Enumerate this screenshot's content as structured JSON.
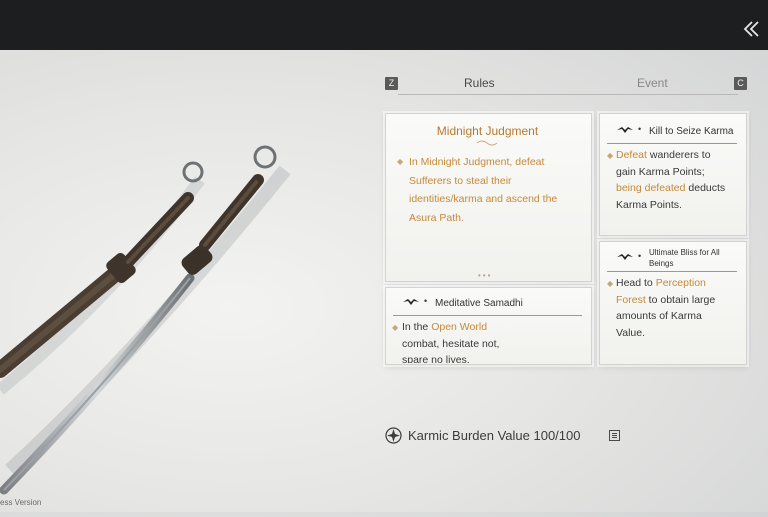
{
  "header": {
    "back_icon": "double-chevron-left-icon"
  },
  "tabs": {
    "left_key": "Z",
    "right_key": "C",
    "items": [
      {
        "label": "Rules",
        "active": true
      },
      {
        "label": "Event",
        "active": false
      }
    ]
  },
  "cards": {
    "midnight": {
      "title": "Midnight Judgment",
      "text": "In Midnight Judgment, defeat Sufferers to steal their identities/karma and ascend the Asura Path."
    },
    "seize": {
      "title": "Kill to Seize Karma",
      "line1_hl": "Defeat",
      "line1_rest": " wanderers to",
      "line2": "gain Karma Points;",
      "line3_hl": "being defeated",
      "line3_rest": " deducts",
      "line4": "Karma Points."
    },
    "bliss": {
      "title": "Ultimate Bliss for All Beings",
      "line1_pre": "Head to ",
      "line1_hl": "Perception",
      "line2_hl": "Forest",
      "line2_rest": " to obtain large",
      "line3": "amounts of Karma",
      "line4": "Value."
    },
    "samadhi": {
      "title": "Meditative Samadhi",
      "line1_pre": "In the ",
      "line1_hl": "Open World",
      "line2": "combat, hesitate not,",
      "line3": "spare no lives."
    }
  },
  "karma": {
    "label": "Karmic Burden Value 100/100",
    "icon": "karma-emblem-icon",
    "info_icon": "info-icon"
  },
  "footer": {
    "version": "ess Version"
  },
  "colors": {
    "accent": "#c48a3c",
    "topbar": "#1d1e20"
  }
}
